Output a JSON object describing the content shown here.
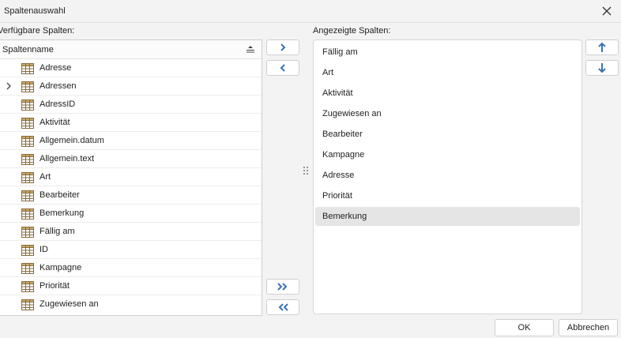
{
  "window": {
    "title": "Spaltenauswahl"
  },
  "available": {
    "label": "Verfügbare Spalten:",
    "column_header": "Spaltenname",
    "rows": [
      {
        "name": "Adresse",
        "expandable": false
      },
      {
        "name": "Adressen",
        "expandable": true
      },
      {
        "name": "AdressID",
        "expandable": false
      },
      {
        "name": "Aktivität",
        "expandable": false
      },
      {
        "name": "Allgemein.datum",
        "expandable": false
      },
      {
        "name": "Allgemein.text",
        "expandable": false
      },
      {
        "name": "Art",
        "expandable": false
      },
      {
        "name": "Bearbeiter",
        "expandable": false
      },
      {
        "name": "Bemerkung",
        "expandable": false
      },
      {
        "name": "Fällig am",
        "expandable": false
      },
      {
        "name": "ID",
        "expandable": false
      },
      {
        "name": "Kampagne",
        "expandable": false
      },
      {
        "name": "Priorität",
        "expandable": false
      },
      {
        "name": "Zugewiesen an",
        "expandable": false
      }
    ]
  },
  "shown": {
    "label": "Angezeigte Spalten:",
    "items": [
      "Fällig am",
      "Art",
      "Aktivität",
      "Zugewiesen an",
      "Bearbeiter",
      "Kampagne",
      "Adresse",
      "Priorität",
      "Bemerkung"
    ],
    "selected": "Bemerkung"
  },
  "icons": {
    "move_right": "chevron-right-icon",
    "move_left": "chevron-left-icon",
    "move_all_right": "double-chevron-right-icon",
    "move_all_left": "double-chevron-left-icon",
    "move_up": "arrow-up-icon",
    "move_down": "arrow-down-icon"
  },
  "colors": {
    "accent": "#3a72b8",
    "selection": "#e5e5e5",
    "grid_icon": "#8a6d3b"
  },
  "buttons": {
    "ok": "OK",
    "cancel": "Abbrechen"
  }
}
